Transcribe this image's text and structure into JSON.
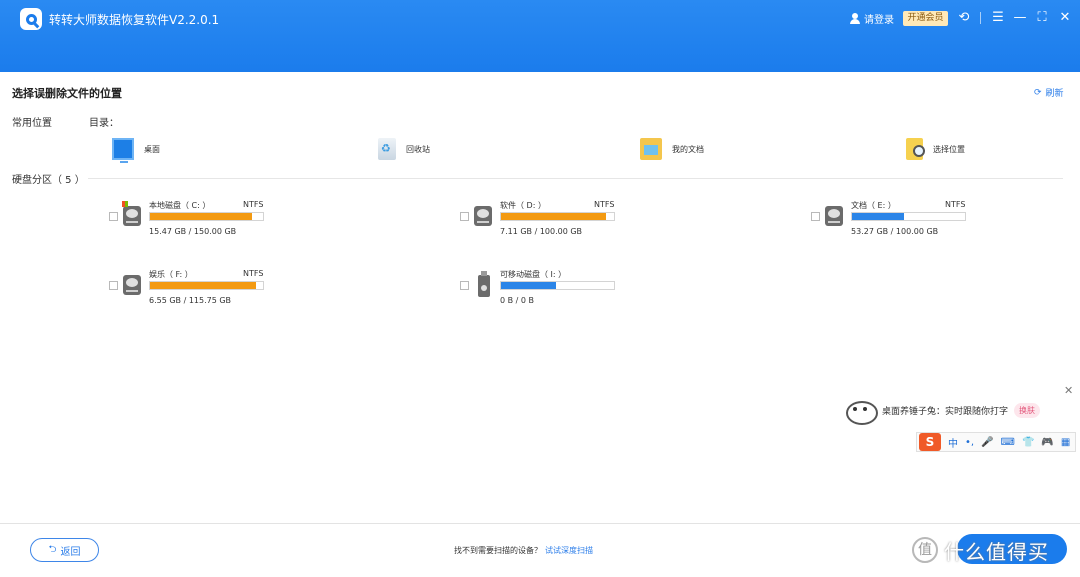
{
  "titlebar": {
    "app_title": "转转大师数据恢复软件V2.2.0.1",
    "login_label": "请登录",
    "vip_label": "开通会员",
    "icons": [
      "user-icon",
      "history-icon",
      "menu-icon",
      "minimize-icon",
      "maximize-icon",
      "close-icon"
    ],
    "accent_color": "#1b7cec"
  },
  "main": {
    "title": "选择误删除文件的位置",
    "refresh_label": "刷新",
    "common_label": "常用位置",
    "directory_label": "目录：",
    "locations": [
      {
        "label": "桌面",
        "icon": "desktop-icon"
      },
      {
        "label": "回收站",
        "icon": "recycle-bin-icon"
      },
      {
        "label": "我的文档",
        "icon": "documents-folder-icon"
      },
      {
        "label": "选择位置",
        "icon": "choose-folder-icon"
      }
    ],
    "partitions_label": "硬盘分区（ 5 ）",
    "drives": [
      {
        "name": "本地磁盘（ C: ）",
        "fs": "NTFS",
        "size": "15.47 GB / 150.00 GB",
        "used_fraction": 0.9,
        "bar_color": "#f39a12",
        "icon": "system-disk-icon"
      },
      {
        "name": "软件（ D: ）",
        "fs": "NTFS",
        "size": "7.11 GB / 100.00 GB",
        "used_fraction": 0.93,
        "bar_color": "#f39a12",
        "icon": "disk-icon"
      },
      {
        "name": "文档（ E: ）",
        "fs": "NTFS",
        "size": "53.27 GB / 100.00 GB",
        "used_fraction": 0.46,
        "bar_color": "#2b85e8",
        "icon": "disk-icon"
      },
      {
        "name": "娱乐（ F: ）",
        "fs": "NTFS",
        "size": "6.55 GB / 115.75 GB",
        "used_fraction": 0.94,
        "bar_color": "#f39a12",
        "icon": "disk-icon"
      },
      {
        "name": "可移动磁盘（ I: ）",
        "fs": "",
        "size": "0 B / 0 B",
        "used_fraction": 0.49,
        "bar_color": "#2b85e8",
        "icon": "usb-drive-icon"
      }
    ]
  },
  "ime": {
    "tip_text": "桌面养锤子兔：实时跟随你打字",
    "skin_label": "换肤",
    "close_glyph": "✕",
    "logo": "S",
    "buttons": [
      "中",
      "•,",
      "🎤",
      "⌨",
      "👕",
      "🎮",
      "▦"
    ]
  },
  "footer": {
    "back_label": "返回",
    "hint_text": "找不到需要扫描的设备？",
    "deep_scan_label": "试试深度扫描",
    "watermark_text": "什么值得买",
    "watermark_glyph": "值"
  }
}
